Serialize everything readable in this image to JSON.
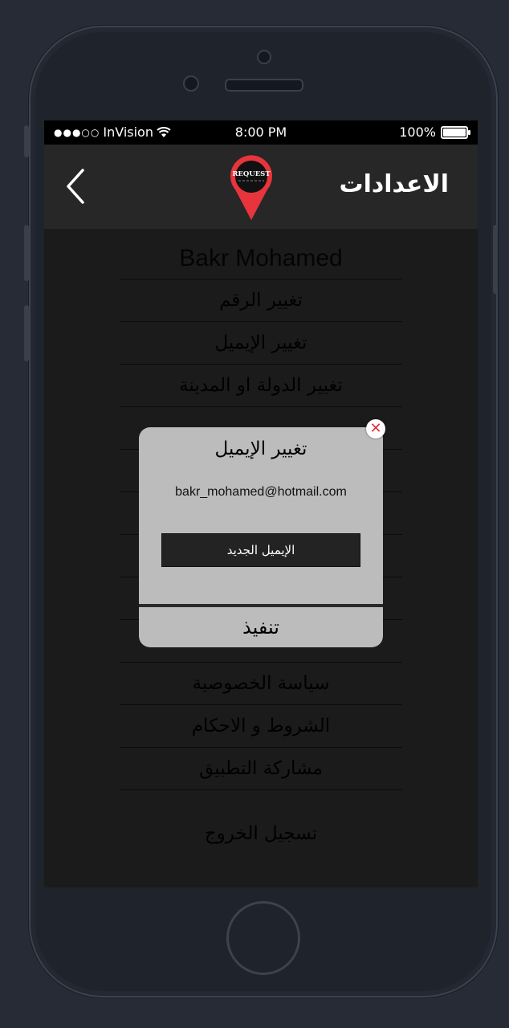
{
  "status_bar": {
    "carrier": "InVision",
    "time": "8:00 PM",
    "battery": "100%"
  },
  "header": {
    "title": "الاعدادات",
    "back_icon": "chevron-left-icon",
    "logo_text": "REQUEST"
  },
  "profile": {
    "name": "Bakr Mohamed"
  },
  "menu": {
    "items": [
      "تغيير الرقم",
      "تغيير الإيميل",
      "تغيير الدولة او المدينة",
      "",
      "",
      "",
      "",
      "",
      "",
      "سياسة الخصوصية",
      "الشروط و الاحكام",
      "مشاركة التطبيق"
    ],
    "logout": "تسجيل الخروج"
  },
  "modal": {
    "title": "تغيير الإيميل",
    "current_email": "bakr_mohamed@hotmail.com",
    "input_placeholder": "الإيميل الجديد",
    "submit_label": "تنفيذ",
    "close_icon": "close-icon"
  },
  "colors": {
    "logo_red": "#e8343c",
    "navbar_bg": "#272727",
    "modal_bg": "#bcbcbc"
  }
}
